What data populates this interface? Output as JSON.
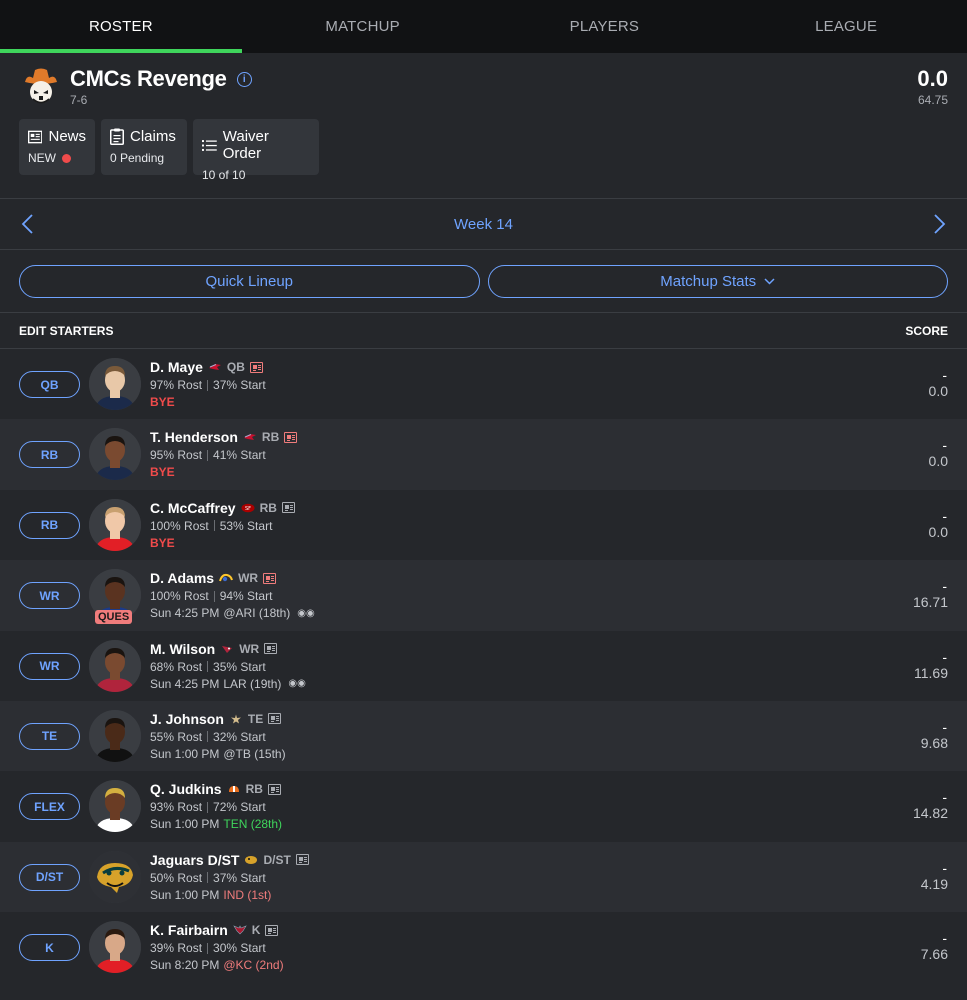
{
  "tabs": [
    "ROSTER",
    "MATCHUP",
    "PLAYERS",
    "LEAGUE"
  ],
  "team": {
    "name": "CMCs Revenge",
    "record": "7-6",
    "score": "0.0",
    "projected": "64.75"
  },
  "cards": {
    "news": {
      "title": "News",
      "sub": "NEW"
    },
    "claims": {
      "title": "Claims",
      "sub": "0 Pending"
    },
    "waiver": {
      "title": "Waiver Order",
      "sub": "10 of 10"
    }
  },
  "week": "Week 14",
  "buttons": {
    "quick_lineup": "Quick Lineup",
    "matchup_stats": "Matchup Stats"
  },
  "list_header": {
    "left": "EDIT STARTERS",
    "right": "SCORE"
  },
  "players": [
    {
      "slot": "QB",
      "name": "D. Maye",
      "pos": "QB",
      "rost": "97% Rost",
      "start": "37% Start",
      "game": "BYE",
      "opp": "",
      "score": "0.0",
      "dash": "-",
      "ques": ""
    },
    {
      "slot": "RB",
      "name": "T. Henderson",
      "pos": "RB",
      "rost": "95% Rost",
      "start": "41% Start",
      "game": "BYE",
      "opp": "",
      "score": "0.0",
      "dash": "-",
      "ques": ""
    },
    {
      "slot": "RB",
      "name": "C. McCaffrey",
      "pos": "RB",
      "rost": "100% Rost",
      "start": "53% Start",
      "game": "BYE",
      "opp": "",
      "score": "0.0",
      "dash": "-",
      "ques": ""
    },
    {
      "slot": "WR",
      "name": "D. Adams",
      "pos": "WR",
      "rost": "100% Rost",
      "start": "94% Start",
      "game": "Sun 4:25 PM",
      "opp": "@ARI (18th)",
      "score": "16.71",
      "dash": "-",
      "ques": "QUES"
    },
    {
      "slot": "WR",
      "name": "M. Wilson",
      "pos": "WR",
      "rost": "68% Rost",
      "start": "35% Start",
      "game": "Sun 4:25 PM",
      "opp": "LAR (19th)",
      "score": "11.69",
      "dash": "-",
      "ques": ""
    },
    {
      "slot": "TE",
      "name": "J. Johnson",
      "pos": "TE",
      "rost": "55% Rost",
      "start": "32% Start",
      "game": "Sun 1:00 PM",
      "opp": "@TB (15th)",
      "score": "9.68",
      "dash": "-",
      "ques": ""
    },
    {
      "slot": "FLEX",
      "name": "Q. Judkins",
      "pos": "RB",
      "rost": "93% Rost",
      "start": "72% Start",
      "game": "Sun 1:00 PM",
      "opp": "TEN (28th)",
      "score": "14.82",
      "dash": "-",
      "ques": ""
    },
    {
      "slot": "D/ST",
      "name": "Jaguars D/ST",
      "pos": "D/ST",
      "rost": "50% Rost",
      "start": "37% Start",
      "game": "Sun 1:00 PM",
      "opp": "IND (1st)",
      "score": "4.19",
      "dash": "-",
      "ques": ""
    },
    {
      "slot": "K",
      "name": "K. Fairbairn",
      "pos": "K",
      "rost": "39% Rost",
      "start": "30% Start",
      "game": "Sun 8:20 PM",
      "opp": "@KC (2nd)",
      "score": "7.66",
      "dash": "-",
      "ques": ""
    }
  ],
  "colors": {
    "accent": "#6fa3ff",
    "active_tab": "#3fd55c",
    "bye": "#f04b4b"
  }
}
